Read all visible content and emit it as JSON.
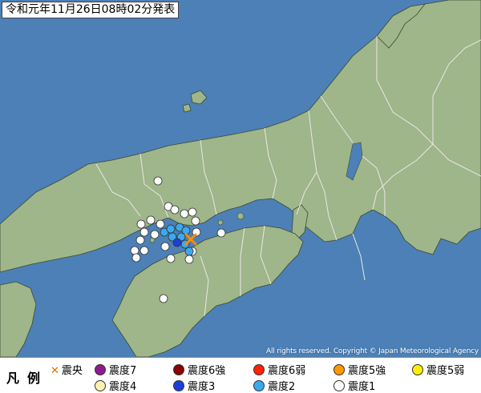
{
  "title": "令和元年11月26日08時02分発表",
  "copyright": "All rights reserved. Copyright © Japan Meteorological Agency",
  "legend": {
    "title": "凡例",
    "epicenter": "震央",
    "items": [
      {
        "label": "震度7",
        "color": "#8e1c8e"
      },
      {
        "label": "震度6強",
        "color": "#8b0000"
      },
      {
        "label": "震度6弱",
        "color": "#ff2200"
      },
      {
        "label": "震度5強",
        "color": "#ff9900"
      },
      {
        "label": "震度5弱",
        "color": "#ffee00"
      },
      {
        "label": "震度4",
        "color": "#fff2b0"
      },
      {
        "label": "震度3",
        "color": "#1b3fd8"
      },
      {
        "label": "震度2",
        "color": "#3ba9f0"
      },
      {
        "label": "震度1",
        "color": "#ffffff"
      }
    ]
  },
  "colors": {
    "sea": "#4c80b6",
    "land": "#9fb58a",
    "border": "#e8e8e8",
    "coast": "#3a4a30"
  }
}
